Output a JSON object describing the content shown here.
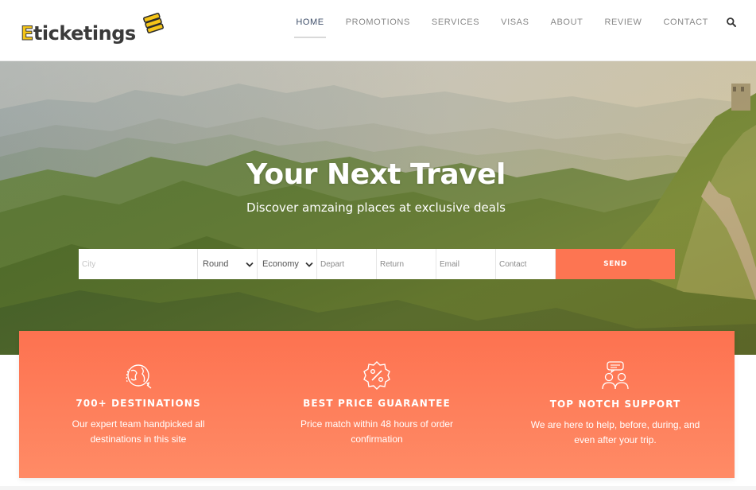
{
  "brand": {
    "logo_first_letter": "E",
    "logo_rest": "ticketings",
    "logo_color": "#f5c518"
  },
  "nav": {
    "items": [
      {
        "label": "HOME",
        "active": true
      },
      {
        "label": "PROMOTIONS",
        "active": false
      },
      {
        "label": "SERVICES",
        "active": false
      },
      {
        "label": "VISAS",
        "active": false
      },
      {
        "label": "ABOUT",
        "active": false
      },
      {
        "label": "REVIEW",
        "active": false
      },
      {
        "label": "CONTACT",
        "active": false
      }
    ],
    "search_icon": "search-icon"
  },
  "hero": {
    "title": "Your Next Travel",
    "subtitle": "Discover amzaing places at exclusive deals"
  },
  "booking": {
    "city_placeholder": "City",
    "trip_type_value": "Round",
    "class_value": "Economy",
    "depart_placeholder": "Depart",
    "return_placeholder": "Return",
    "email_placeholder": "Email",
    "contact_placeholder": "Contact",
    "send_label": "SEND"
  },
  "features": [
    {
      "icon": "globe-icon",
      "title": "700+ DESTINATIONS",
      "text": "Our expert team handpicked all destinations in this site"
    },
    {
      "icon": "discount-badge-icon",
      "title": "BEST PRICE GUARANTEE",
      "text": "Price match within 48 hours of order confirmation"
    },
    {
      "icon": "support-chat-icon",
      "title": "TOP NOTCH SUPPORT",
      "text": "We are here to help, before, during, and even after your trip."
    }
  ],
  "colors": {
    "accent": "#fd7552",
    "nav_active": "#3f4f6a",
    "nav_text": "#888888"
  }
}
